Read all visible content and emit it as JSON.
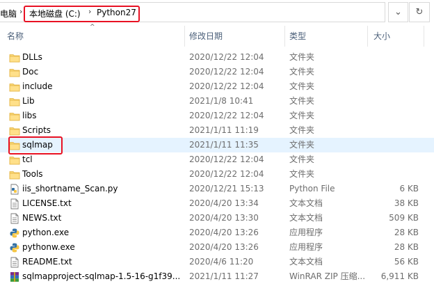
{
  "breadcrumb": {
    "root_partial": "电脑",
    "drive": "本地磁盘 (C:)",
    "folder": "Python27",
    "separator": "›"
  },
  "toolbar": {
    "dropdown_glyph": "⌄",
    "refresh_glyph": "↻"
  },
  "columns": {
    "name": "名称",
    "date": "修改日期",
    "type": "类型",
    "size": "大小",
    "sort_glyph": "^"
  },
  "files": [
    {
      "name": "DLLs",
      "date": "2020/12/22 12:04",
      "type": "文件夹",
      "size": "",
      "icon": "folder-icon"
    },
    {
      "name": "Doc",
      "date": "2020/12/22 12:04",
      "type": "文件夹",
      "size": "",
      "icon": "folder-icon"
    },
    {
      "name": "include",
      "date": "2020/12/22 12:04",
      "type": "文件夹",
      "size": "",
      "icon": "folder-icon"
    },
    {
      "name": "Lib",
      "date": "2021/1/8 10:41",
      "type": "文件夹",
      "size": "",
      "icon": "folder-icon"
    },
    {
      "name": "libs",
      "date": "2020/12/22 12:04",
      "type": "文件夹",
      "size": "",
      "icon": "folder-icon"
    },
    {
      "name": "Scripts",
      "date": "2021/1/11 11:19",
      "type": "文件夹",
      "size": "",
      "icon": "folder-icon"
    },
    {
      "name": "sqlmap",
      "date": "2021/1/11 11:35",
      "type": "文件夹",
      "size": "",
      "icon": "folder-icon"
    },
    {
      "name": "tcl",
      "date": "2020/12/22 12:04",
      "type": "文件夹",
      "size": "",
      "icon": "folder-icon"
    },
    {
      "name": "Tools",
      "date": "2020/12/22 12:04",
      "type": "文件夹",
      "size": "",
      "icon": "folder-icon"
    },
    {
      "name": "iis_shortname_Scan.py",
      "date": "2020/12/21 15:13",
      "type": "Python File",
      "size": "6 KB",
      "icon": "python-file-icon"
    },
    {
      "name": "LICENSE.txt",
      "date": "2020/4/20 13:34",
      "type": "文本文档",
      "size": "38 KB",
      "icon": "text-file-icon"
    },
    {
      "name": "NEWS.txt",
      "date": "2020/4/20 13:30",
      "type": "文本文档",
      "size": "509 KB",
      "icon": "text-file-icon"
    },
    {
      "name": "python.exe",
      "date": "2020/4/20 13:26",
      "type": "应用程序",
      "size": "28 KB",
      "icon": "python-exe-icon"
    },
    {
      "name": "pythonw.exe",
      "date": "2020/4/20 13:26",
      "type": "应用程序",
      "size": "28 KB",
      "icon": "python-exe-icon"
    },
    {
      "name": "README.txt",
      "date": "2020/4/6 11:20",
      "type": "文本文档",
      "size": "56 KB",
      "icon": "text-file-icon"
    },
    {
      "name": "sqlmapproject-sqlmap-1.5-16-g1f39...",
      "date": "2021/1/11 11:27",
      "type": "WinRAR ZIP 压缩...",
      "size": "6,911 KB",
      "icon": "winrar-archive-icon"
    }
  ],
  "colors": {
    "folder": "#f8d775",
    "highlight_box": "#e81123",
    "selected_row": "#e5f3ff",
    "header_text": "#4c607a"
  }
}
